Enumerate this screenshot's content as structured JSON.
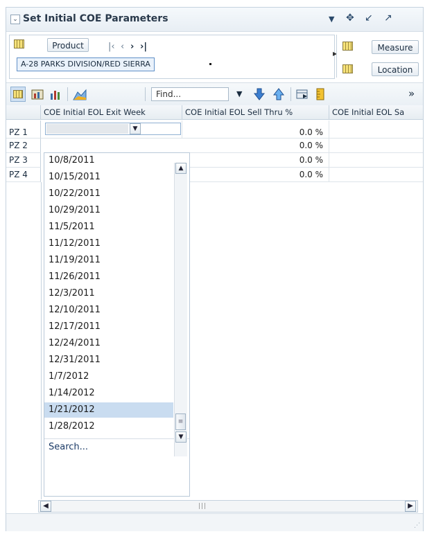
{
  "header": {
    "title": "Set Initial COE Parameters"
  },
  "pov": {
    "product_label": "Product",
    "product_member": "A-28 PARKS DIVISION/RED SIERRA",
    "measure_label": "Measure",
    "location_label": "Location"
  },
  "toolbar": {
    "find_placeholder": "Find..."
  },
  "table": {
    "columns": [
      "COE Initial EOL Exit Week",
      "COE Initial EOL Sell Thru %",
      "COE Initial EOL Sa"
    ],
    "rows": [
      {
        "label": "PZ 1",
        "sell_thru": "0.0 %"
      },
      {
        "label": "PZ 2",
        "sell_thru": "0.0 %"
      },
      {
        "label": "PZ 3",
        "sell_thru": "0.0 %"
      },
      {
        "label": "PZ 4",
        "sell_thru": "0.0 %"
      }
    ]
  },
  "dropdown": {
    "options": [
      "10/8/2011",
      "10/15/2011",
      "10/22/2011",
      "10/29/2011",
      "11/5/2011",
      "11/12/2011",
      "11/19/2011",
      "11/26/2011",
      "12/3/2011",
      "12/10/2011",
      "12/17/2011",
      "12/24/2011",
      "12/31/2011",
      "1/7/2012",
      "1/14/2012",
      "1/21/2012",
      "1/28/2012"
    ],
    "selected": "1/21/2012",
    "search_label": "Search..."
  },
  "colors": {
    "accent": "#5f8fc7",
    "selection": "#c9dcf0",
    "border": "#c5d2de"
  }
}
